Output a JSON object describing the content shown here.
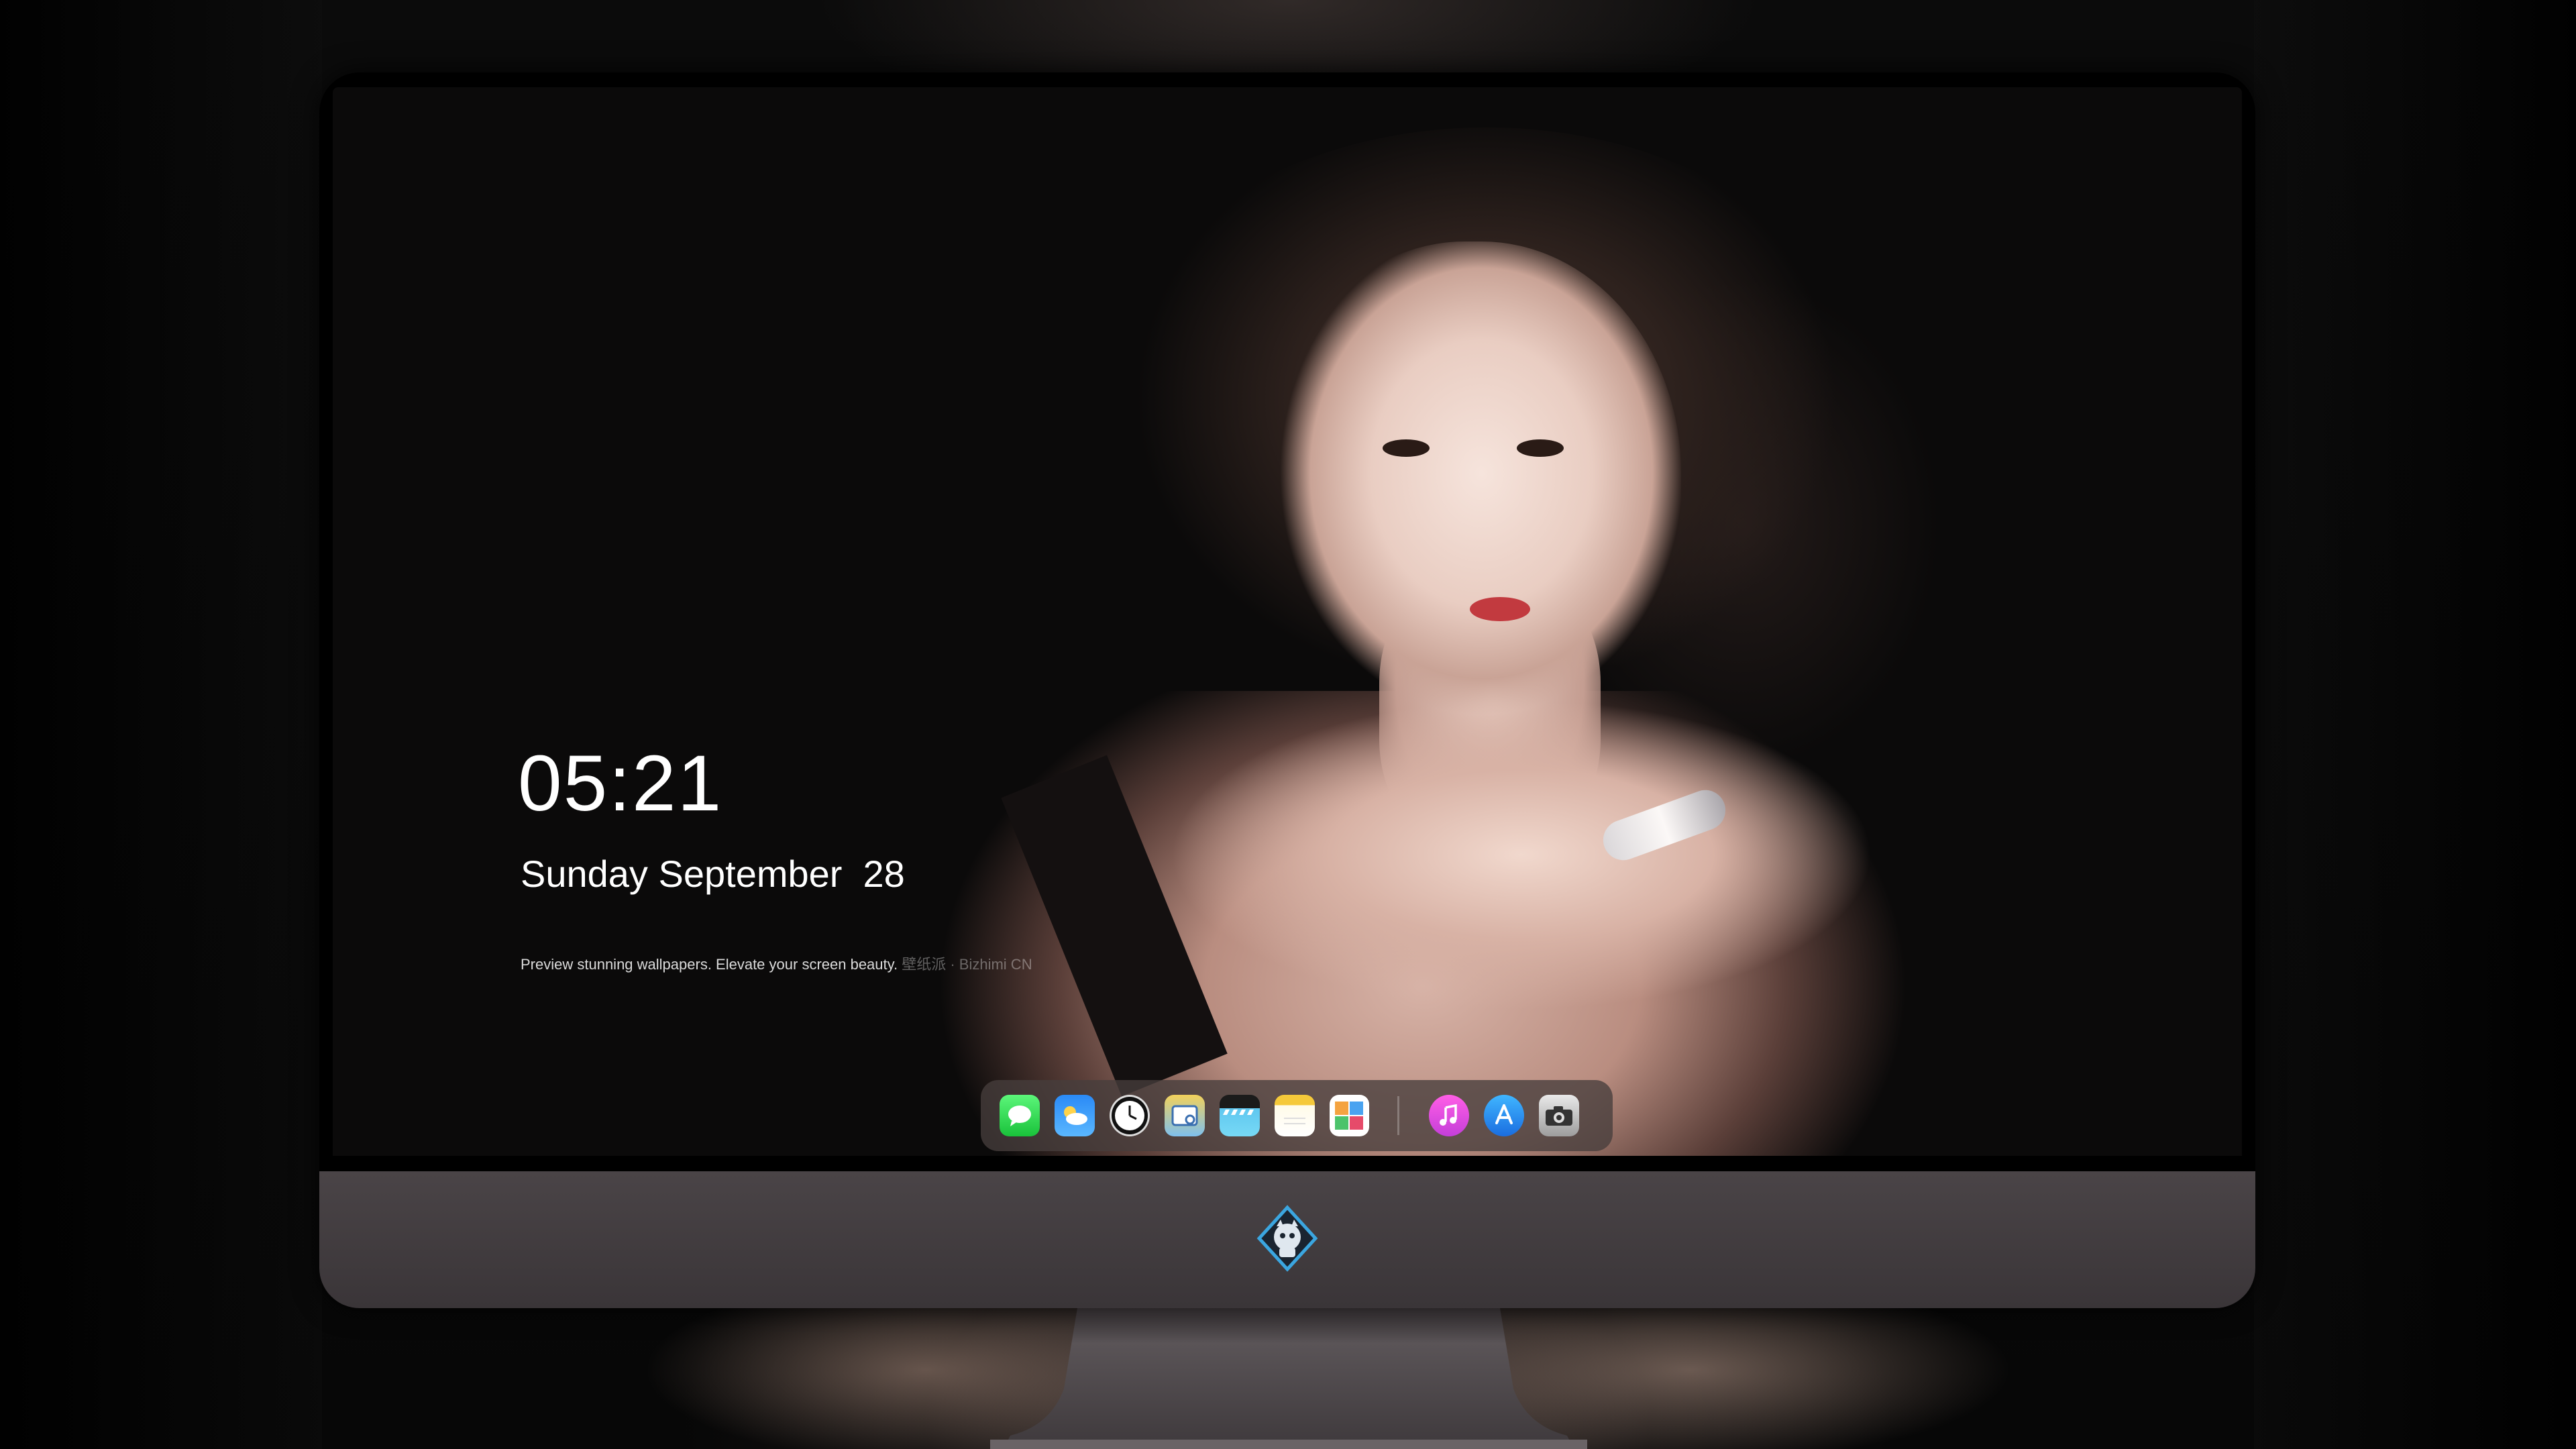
{
  "lockscreen": {
    "time": "05:21",
    "date": "Sunday September  28",
    "tagline": "Preview stunning wallpapers. Elevate your screen beauty.",
    "tagline_faint": "壁纸派 · Bizhimi CN"
  },
  "dock": {
    "apps": [
      {
        "icon": "messages-icon",
        "color": "#2bd64a"
      },
      {
        "icon": "weather-icon",
        "color": "#2a8af6"
      },
      {
        "icon": "clock-icon",
        "color": "#111111"
      },
      {
        "icon": "finder-icon",
        "color": "#f2d15b"
      },
      {
        "icon": "video-icon",
        "color": "#5fc7f0"
      },
      {
        "icon": "notes-icon",
        "color": "#f5c93a"
      },
      {
        "icon": "photos-icon",
        "color": "#ffffff"
      },
      {
        "icon": "music-icon",
        "color": "#ff5ee6"
      },
      {
        "icon": "app-store-icon",
        "color": "#1a6de0"
      },
      {
        "icon": "camera-icon",
        "color": "#9d9d9d"
      }
    ]
  },
  "colors": {
    "bezel": "#000000",
    "chin": "#4a4447",
    "stand": "#4f4a4d",
    "accent_logo": "#3ba6e0"
  }
}
